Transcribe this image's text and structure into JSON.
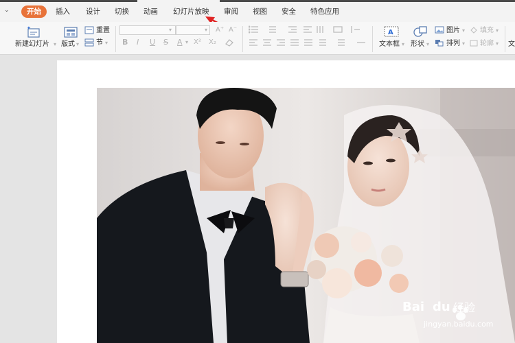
{
  "tabs": [
    "开始",
    "插入",
    "设计",
    "切换",
    "动画",
    "幻灯片放映",
    "审阅",
    "视图",
    "安全",
    "特色应用"
  ],
  "ribbon": {
    "new_slide": "新建幻灯片",
    "layout": "版式",
    "reset": "重置",
    "section": "节",
    "text_box": "文本框",
    "shape": "形状",
    "picture": "图片",
    "fill": "填充",
    "arrange": "排列",
    "outline": "轮廓",
    "right_cut": "文"
  },
  "format_glyphs": [
    "B",
    "I",
    "U",
    "S",
    "A",
    "X²",
    "X₂"
  ],
  "watermark": {
    "brand": "Bai",
    "brand2": "du",
    "cn": "经验",
    "url": "jingyan.baidu.com"
  },
  "colors": {
    "accent": "#e8733a",
    "arrow": "#e02424"
  }
}
